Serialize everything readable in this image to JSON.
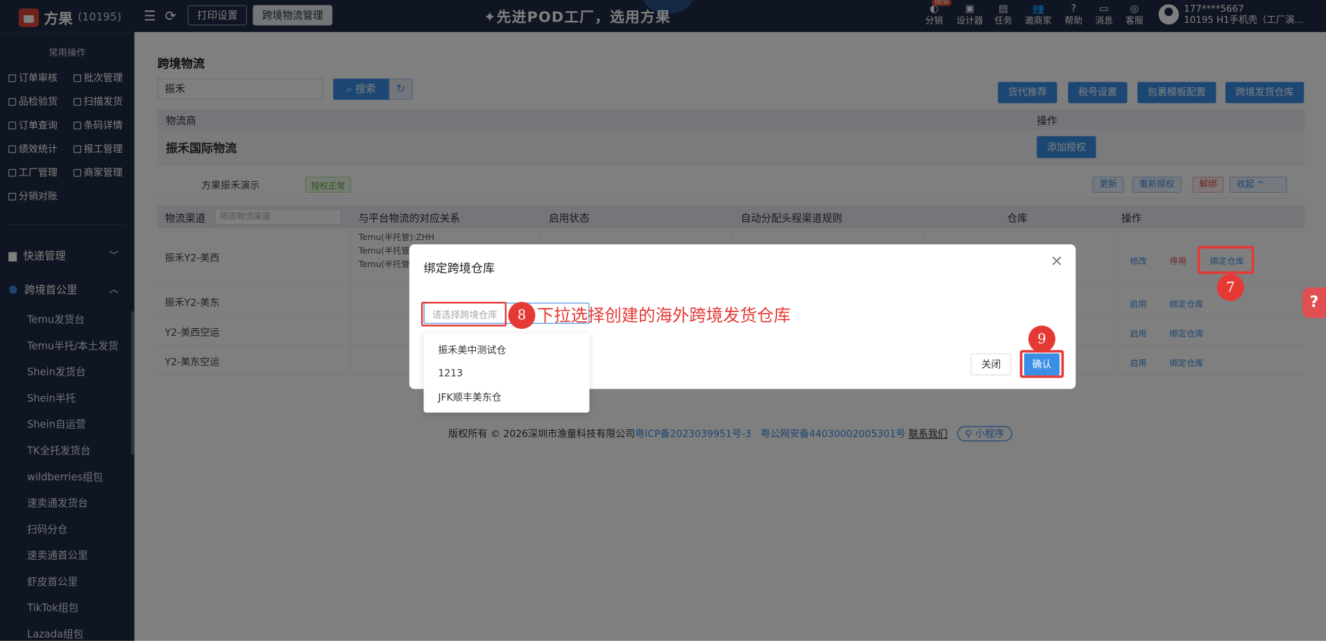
{
  "header": {
    "brand": "方果",
    "brand_id": "(10195)",
    "buttons": [
      {
        "label": "打印设置"
      },
      {
        "label": "跨境物流管理"
      }
    ],
    "slogan": "✦先进POD工厂，选用方果",
    "nav": [
      {
        "label": "分销",
        "icon": "distribution-icon",
        "badge": "NEW"
      },
      {
        "label": "设计器",
        "icon": "image-icon"
      },
      {
        "label": "任务",
        "icon": "task-icon"
      },
      {
        "label": "邀商家",
        "icon": "invite-icon"
      },
      {
        "label": "帮助",
        "icon": "help-icon"
      },
      {
        "label": "消息",
        "icon": "message-icon"
      },
      {
        "label": "客服",
        "icon": "service-icon"
      }
    ],
    "user": {
      "phone": "177****5667",
      "name": "10195  H1手机壳（工厂演..."
    }
  },
  "sidebar": {
    "section_title": "常用操作",
    "quick": [
      {
        "label": "订单审核"
      },
      {
        "label": "批次管理"
      },
      {
        "label": "品检验货"
      },
      {
        "label": "扫描发货"
      },
      {
        "label": "订单查询"
      },
      {
        "label": "条码详情"
      },
      {
        "label": "绩效统计"
      },
      {
        "label": "报工管理"
      },
      {
        "label": "工厂管理"
      },
      {
        "label": "商家管理"
      },
      {
        "label": "分销对账"
      }
    ],
    "groups": [
      {
        "label": "快递管理",
        "icon": "package-icon"
      },
      {
        "label": "跨境首公里",
        "icon": "globe-icon"
      }
    ],
    "items": [
      {
        "label": "Temu发货台"
      },
      {
        "label": "Temu半托/本土发货"
      },
      {
        "label": "Shein发货台"
      },
      {
        "label": "Shein半托"
      },
      {
        "label": "Shein自运营"
      },
      {
        "label": "TK全托发货台"
      },
      {
        "label": "wildberries组包"
      },
      {
        "label": "速卖通发货台"
      },
      {
        "label": "扫码分仓"
      },
      {
        "label": "速卖通首公里"
      },
      {
        "label": "虾皮首公里"
      },
      {
        "label": "TikTok组包"
      },
      {
        "label": "Lazada组包"
      }
    ]
  },
  "main": {
    "title": "跨境物流",
    "search_value": "振禾",
    "search_label": "搜索",
    "actions": [
      {
        "label": "货代推荐"
      },
      {
        "label": "税号设置"
      },
      {
        "label": "包裹模板配置"
      },
      {
        "label": "跨境发货仓库"
      }
    ],
    "table_head": {
      "provider": "物流商",
      "op": "操作"
    },
    "provider": {
      "name": "振禾国际物流",
      "add_auth": "添加授权"
    },
    "account": {
      "name": "方果振禾演示",
      "status": "授权正常",
      "btns": {
        "refresh": "更新",
        "reauth": "重新授权",
        "unbind": "解绑",
        "collapse": "收起 ^"
      }
    },
    "channel_head": {
      "channel": "物流渠道",
      "filter_placeholder": "筛选物流渠道",
      "mapping": "与平台物流的对应关系",
      "status": "启用状态",
      "rule": "自动分配头程渠道规则",
      "warehouse": "仓库",
      "op": "操作"
    },
    "rows": [
      {
        "name": "振禾Y2-美西",
        "mapping": [
          "Temu(半托管):ZHH",
          "Temu(半托管-",
          "Temu(半托管-"
        ],
        "ops": [
          "修改",
          "停用",
          "绑定仓库"
        ]
      },
      {
        "name": "振禾Y2-美东",
        "ops": [
          "启用",
          "绑定仓库"
        ]
      },
      {
        "name": "Y2-美西空运",
        "ops": [
          "启用",
          "绑定仓库"
        ]
      },
      {
        "name": "Y2-美东空运",
        "ops": [
          "启用",
          "绑定仓库"
        ]
      }
    ],
    "footer": {
      "copyright": "版权所有 © 2026深圳市渔童科技有限公司",
      "icp": "粤ICP备2023039951号-3",
      "police": "粤公网安备44030002005301号",
      "contact": "联系我们",
      "mini": "小程序"
    }
  },
  "modal": {
    "title": "绑定跨境仓库",
    "select_placeholder": "请选择跨境仓库",
    "options": [
      "振禾美中测试仓",
      "1213",
      "JFK顺丰美东仓"
    ],
    "cancel": "关闭",
    "confirm": "确认",
    "annotation": "下拉选择创建的海外跨境发货仓库",
    "steps": [
      "7",
      "8",
      "9"
    ]
  },
  "colors": {
    "primary": "#3a8ee6",
    "sidebar": "#1f2a44",
    "highlight": "#e53935"
  }
}
